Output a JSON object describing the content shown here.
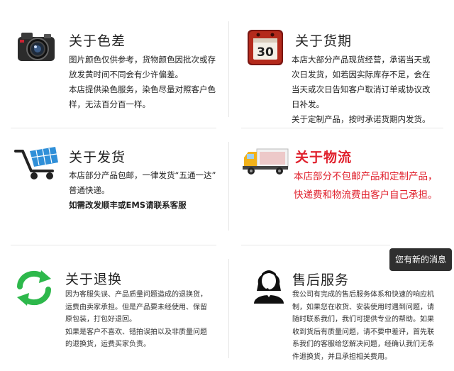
{
  "sections": {
    "color": {
      "title": "关于色差",
      "lines": [
        "图片颜色仅供参考，货物颜色因批次或存",
        "放发黄时间不同会有少许偏差。",
        "本店提供染色服务，染色尽量对照客户色",
        "样，无法百分百一样。"
      ]
    },
    "delivery_time": {
      "title": "关于货期",
      "calendar_day": "30",
      "lines": [
        "本店大部分产品现货经营，承诺当天或",
        "次日发货，如若因实际库存不足，会在",
        "当天或次日告知客户取消订单或协议改",
        "日补发。",
        "关于定制产品，按时承诺货期内发货。"
      ]
    },
    "shipping": {
      "title": "关于发货",
      "lines": [
        "本店部分产品包邮，一律发货“五通一达”",
        "普通快递。"
      ],
      "bold_line": "如需改发顺丰或EMS请联系客服"
    },
    "logistics": {
      "title": "关于物流",
      "lines": [
        "本店部分不包邮产品和定制产品，",
        "快递费和物流费由客户自己承担。"
      ]
    },
    "returns": {
      "title": "关于退换",
      "lines": [
        "因为客服失误、产品质量问题造成的退换货，",
        "运费由卖家承担。但是产品要未经使用、保留",
        "原包装，打包好退回。",
        "如果是客户不喜欢、错拍误拍以及非质量问题",
        "的退换货，运费买家负责。"
      ]
    },
    "after_sales": {
      "title": "售后服务",
      "lines": [
        "我公司有完成的售后服务体系和快速的响应机",
        "制，如果您在收货、安装使用时遇到问题，请",
        "随时联系我们，我们可提供专业的帮助。如果",
        "收到货后有质量问题，请不要中差评，首先联",
        "系我们的客服给您解决问题，经确认我们无条",
        "件退换货，并且承担相关费用。"
      ]
    }
  },
  "toast": {
    "text": "您有新的消息"
  },
  "colors": {
    "accent_red": "#e0202c",
    "toast_bg": "#2f2f2f"
  },
  "icons": [
    "camera-icon",
    "calendar-icon",
    "cart-icon",
    "truck-icon",
    "refresh-arrows-icon",
    "customer-service-icon"
  ]
}
